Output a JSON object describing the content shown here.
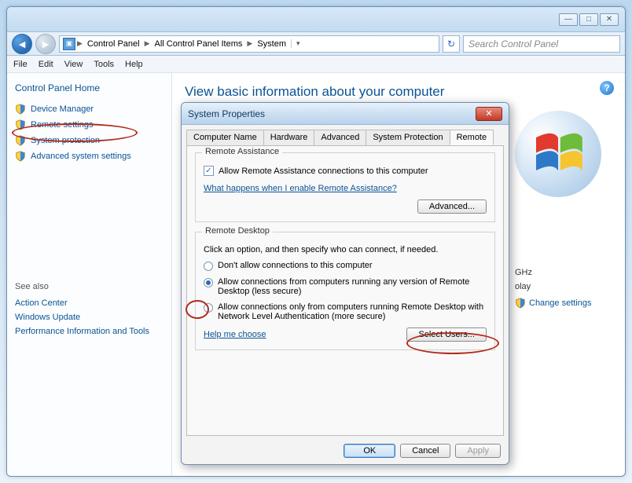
{
  "titlebar": {
    "min_icon": "—",
    "max_icon": "□",
    "close_icon": "✕"
  },
  "nav": {
    "back_icon": "◄",
    "forward_icon": "►",
    "refresh_icon": "↻",
    "breadcrumb": [
      "Control Panel",
      "All Control Panel Items",
      "System"
    ],
    "search_placeholder": "Search Control Panel"
  },
  "menu": [
    "File",
    "Edit",
    "View",
    "Tools",
    "Help"
  ],
  "sidebar": {
    "header": "Control Panel Home",
    "links": [
      "Device Manager",
      "Remote settings",
      "System protection",
      "Advanced system settings"
    ],
    "see_also_title": "See also",
    "see_also": [
      "Action Center",
      "Windows Update",
      "Performance Information and Tools"
    ]
  },
  "content": {
    "heading": "View basic information about your computer",
    "help_icon": "?",
    "right": {
      "ghz": "GHz",
      "display": "olay",
      "change_settings": "Change settings"
    }
  },
  "dialog": {
    "title": "System Properties",
    "close_icon": "✕",
    "tabs": [
      "Computer Name",
      "Hardware",
      "Advanced",
      "System Protection",
      "Remote"
    ],
    "active_tab": "Remote",
    "remote_assistance": {
      "legend": "Remote Assistance",
      "checkbox_label": "Allow Remote Assistance connections to this computer",
      "checkbox_checked": "✓",
      "link": "What happens when I enable Remote Assistance?",
      "advanced_btn": "Advanced..."
    },
    "remote_desktop": {
      "legend": "Remote Desktop",
      "intro": "Click an option, and then specify who can connect, if needed.",
      "opt1": "Don't allow connections to this computer",
      "opt2": "Allow connections from computers running any version of Remote Desktop (less secure)",
      "opt3": "Allow connections only from computers running Remote Desktop with Network Level Authentication (more secure)",
      "help_link": "Help me choose",
      "select_users_btn": "Select Users..."
    },
    "buttons": {
      "ok": "OK",
      "cancel": "Cancel",
      "apply": "Apply"
    }
  }
}
